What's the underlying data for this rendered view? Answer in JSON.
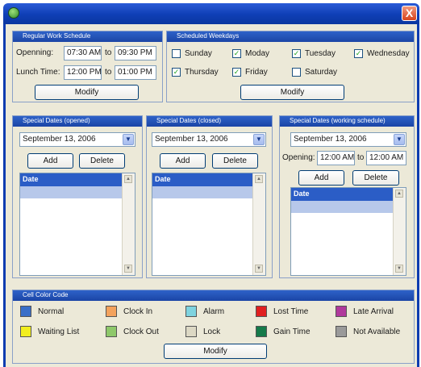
{
  "window": {
    "close_label": "X"
  },
  "regular_schedule": {
    "title": "Regular Work Schedule",
    "opening_label": "Openning:",
    "opening_from": "07:30 AM",
    "opening_sep": "to",
    "opening_to": "09:30 PM",
    "lunch_label": "Lunch Time:",
    "lunch_from": "12:00 PM",
    "lunch_sep": "to",
    "lunch_to": "01:00 PM",
    "modify_label": "Modify"
  },
  "weekdays": {
    "title": "Scheduled Weekdays",
    "days": [
      {
        "label": "Sunday",
        "checked": false
      },
      {
        "label": "Moday",
        "checked": true
      },
      {
        "label": "Tuesday",
        "checked": true
      },
      {
        "label": "Wednesday",
        "checked": true
      },
      {
        "label": "Thursday",
        "checked": true
      },
      {
        "label": "Friday",
        "checked": true
      },
      {
        "label": "Saturday",
        "checked": false
      }
    ],
    "modify_label": "Modify"
  },
  "special_opened": {
    "title": "Special Dates (opened)",
    "date": "September 13, 2006",
    "add_label": "Add",
    "delete_label": "Delete",
    "list_header": "Date"
  },
  "special_closed": {
    "title": "Special Dates (closed)",
    "date": "September 13, 2006",
    "add_label": "Add",
    "delete_label": "Delete",
    "list_header": "Date"
  },
  "special_working": {
    "title": "Special Dates (working schedule)",
    "date": "September 13, 2006",
    "opening_label": "Opening:",
    "opening_from": "12:00 AM",
    "opening_sep": "to",
    "opening_to": "12:00 AM",
    "add_label": "Add",
    "delete_label": "Delete",
    "list_header": "Date"
  },
  "color_code": {
    "title": "Cell Color Code",
    "items": [
      {
        "label": "Normal",
        "color": "#3a6fc8"
      },
      {
        "label": "Clock In",
        "color": "#f3a25d"
      },
      {
        "label": "Alarm",
        "color": "#7fd3df"
      },
      {
        "label": "Lost Time",
        "color": "#e02020"
      },
      {
        "label": "Late Arrival",
        "color": "#b0399c"
      },
      {
        "label": "Waiting List",
        "color": "#f2ee1e"
      },
      {
        "label": "Clock Out",
        "color": "#8ec86a"
      },
      {
        "label": "Lock",
        "color": "#dcd8c4"
      },
      {
        "label": "Gain Time",
        "color": "#157a4a"
      },
      {
        "label": "Not Available",
        "color": "#9a9a9a"
      }
    ],
    "modify_label": "Modify"
  }
}
